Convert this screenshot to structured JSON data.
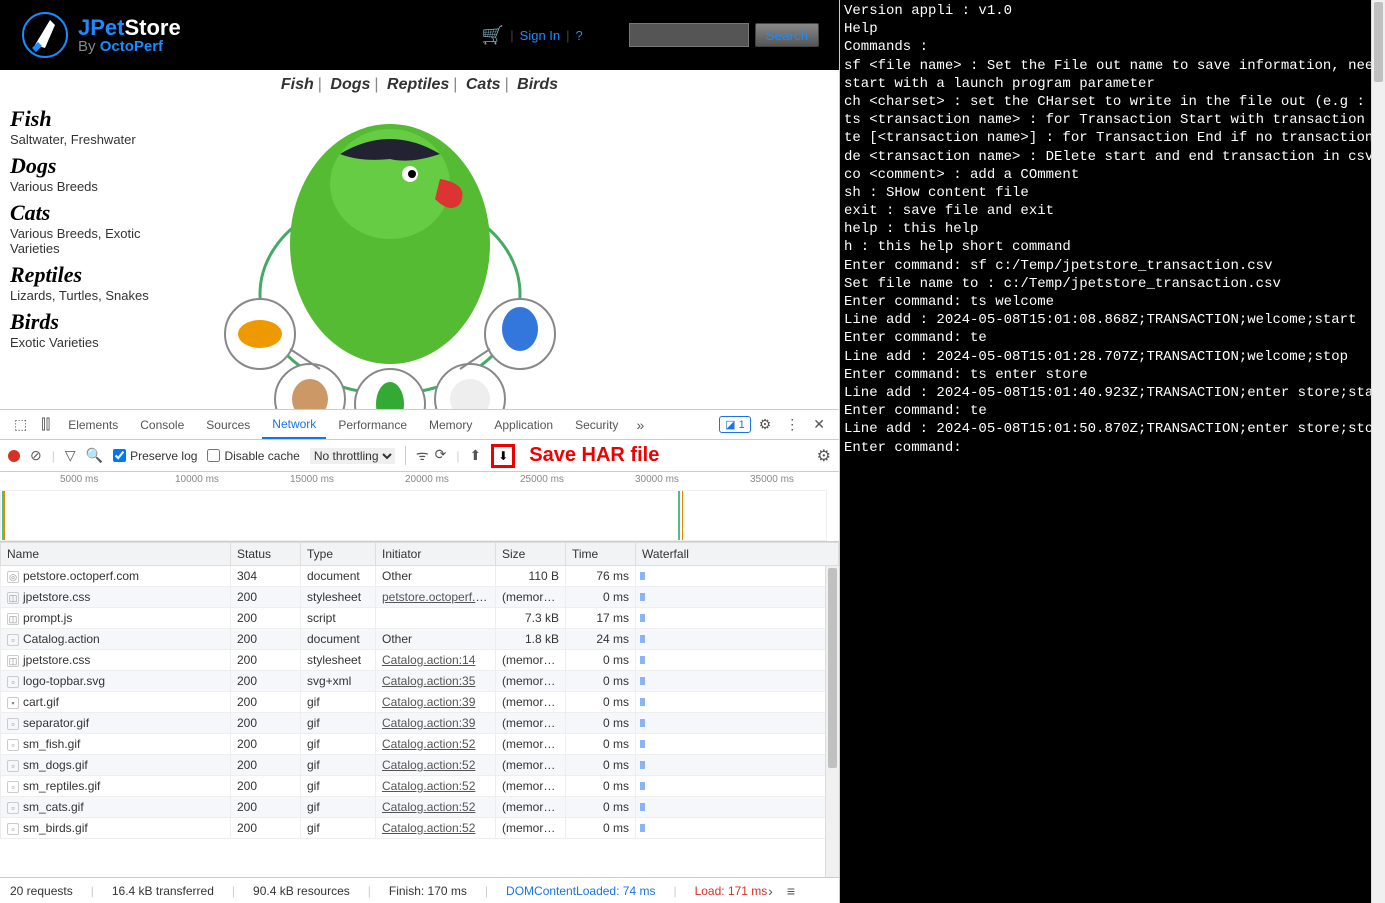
{
  "petstore": {
    "logo": {
      "line1a": "JPet",
      "line1b": "Store",
      "line2a": "By",
      "line2b": "OctoPerf"
    },
    "nav": {
      "signin": "Sign In",
      "help": "?",
      "search_btn": "Search"
    },
    "catbar": [
      "Fish",
      "Dogs",
      "Reptiles",
      "Cats",
      "Birds"
    ],
    "categories": [
      {
        "title": "Fish",
        "desc": "Saltwater, Freshwater"
      },
      {
        "title": "Dogs",
        "desc": "Various Breeds"
      },
      {
        "title": "Cats",
        "desc": "Various Breeds, Exotic Varieties"
      },
      {
        "title": "Reptiles",
        "desc": "Lizards, Turtles, Snakes"
      },
      {
        "title": "Birds",
        "desc": "Exotic Varieties"
      }
    ]
  },
  "devtools": {
    "tabs": [
      "Elements",
      "Console",
      "Sources",
      "Network",
      "Performance",
      "Memory",
      "Application",
      "Security"
    ],
    "active_tab": "Network",
    "issues_count": "1",
    "toolbar": {
      "preserve_log": "Preserve log",
      "disable_cache": "Disable cache",
      "throttling": "No throttling"
    },
    "save_har_label": "Save HAR file",
    "timeline_ticks": [
      "5000 ms",
      "10000 ms",
      "15000 ms",
      "20000 ms",
      "25000 ms",
      "30000 ms",
      "35000 ms"
    ],
    "headers": [
      "Name",
      "Status",
      "Type",
      "Initiator",
      "Size",
      "Time",
      "Waterfall"
    ],
    "rows": [
      {
        "name": "petstore.octoperf.com",
        "status": "304",
        "type": "document",
        "initiator": "Other",
        "initiator_link": false,
        "size": "110 B",
        "time": "76 ms",
        "icon": "◎"
      },
      {
        "name": "jpetstore.css",
        "status": "200",
        "type": "stylesheet",
        "initiator": "petstore.octoperf.com",
        "initiator_link": true,
        "size": "(memory …",
        "time": "0 ms",
        "icon": "◫"
      },
      {
        "name": "prompt.js",
        "status": "200",
        "type": "script",
        "initiator": "",
        "initiator_link": false,
        "size": "7.3 kB",
        "time": "17 ms",
        "icon": "◫"
      },
      {
        "name": "Catalog.action",
        "status": "200",
        "type": "document",
        "initiator": "Other",
        "initiator_link": false,
        "size": "1.8 kB",
        "time": "24 ms",
        "icon": "▫"
      },
      {
        "name": "jpetstore.css",
        "status": "200",
        "type": "stylesheet",
        "initiator": "Catalog.action:14",
        "initiator_link": true,
        "size": "(memory …",
        "time": "0 ms",
        "icon": "◫"
      },
      {
        "name": "logo-topbar.svg",
        "status": "200",
        "type": "svg+xml",
        "initiator": "Catalog.action:35",
        "initiator_link": true,
        "size": "(memory …",
        "time": "0 ms",
        "icon": "▫"
      },
      {
        "name": "cart.gif",
        "status": "200",
        "type": "gif",
        "initiator": "Catalog.action:39",
        "initiator_link": true,
        "size": "(memory …",
        "time": "0 ms",
        "icon": "▪"
      },
      {
        "name": "separator.gif",
        "status": "200",
        "type": "gif",
        "initiator": "Catalog.action:39",
        "initiator_link": true,
        "size": "(memory …",
        "time": "0 ms",
        "icon": "▫"
      },
      {
        "name": "sm_fish.gif",
        "status": "200",
        "type": "gif",
        "initiator": "Catalog.action:52",
        "initiator_link": true,
        "size": "(memory …",
        "time": "0 ms",
        "icon": "▫"
      },
      {
        "name": "sm_dogs.gif",
        "status": "200",
        "type": "gif",
        "initiator": "Catalog.action:52",
        "initiator_link": true,
        "size": "(memory …",
        "time": "0 ms",
        "icon": "▫"
      },
      {
        "name": "sm_reptiles.gif",
        "status": "200",
        "type": "gif",
        "initiator": "Catalog.action:52",
        "initiator_link": true,
        "size": "(memory …",
        "time": "0 ms",
        "icon": "▫"
      },
      {
        "name": "sm_cats.gif",
        "status": "200",
        "type": "gif",
        "initiator": "Catalog.action:52",
        "initiator_link": true,
        "size": "(memory …",
        "time": "0 ms",
        "icon": "▫"
      },
      {
        "name": "sm_birds.gif",
        "status": "200",
        "type": "gif",
        "initiator": "Catalog.action:52",
        "initiator_link": true,
        "size": "(memory …",
        "time": "0 ms",
        "icon": "▫"
      }
    ],
    "status": {
      "requests": "20 requests",
      "transferred": "16.4 kB transferred",
      "resources": "90.4 kB resources",
      "finish": "Finish: 170 ms",
      "dcl": "DOMContentLoaded: 74 ms",
      "load": "Load: 171 ms"
    }
  },
  "terminal": {
    "lines": [
      "Version appli : v1.0",
      "Help",
      "Commands :",
      "sf <file name> : Set the File out name to save information, need to",
      "start with a launch program parameter",
      "ch <charset> : set the CHarset to write in the file out (e.g : UTF-",
      "ts <transaction name> : for Transaction Start with transaction name",
      "te [<transaction name>] : for Transaction End if no transaction nam",
      "de <transaction name> : DElete start and end transaction in csv fil",
      "co <comment> : add a COmment",
      "sh : SHow content file",
      "exit : save file and exit",
      "help : this help",
      "h : this help short command",
      "Enter command: sf c:/Temp/jpetstore_transaction.csv",
      "Set file name to : c:/Temp/jpetstore_transaction.csv",
      "Enter command: ts welcome",
      "Line add : 2024-05-08T15:01:08.868Z;TRANSACTION;welcome;start",
      "Enter command: te",
      "Line add : 2024-05-08T15:01:28.707Z;TRANSACTION;welcome;stop",
      "Enter command: ts enter store",
      "Line add : 2024-05-08T15:01:40.923Z;TRANSACTION;enter store;start",
      "Enter command: te",
      "Line add : 2024-05-08T15:01:50.870Z;TRANSACTION;enter store;stop",
      "Enter command:"
    ]
  }
}
